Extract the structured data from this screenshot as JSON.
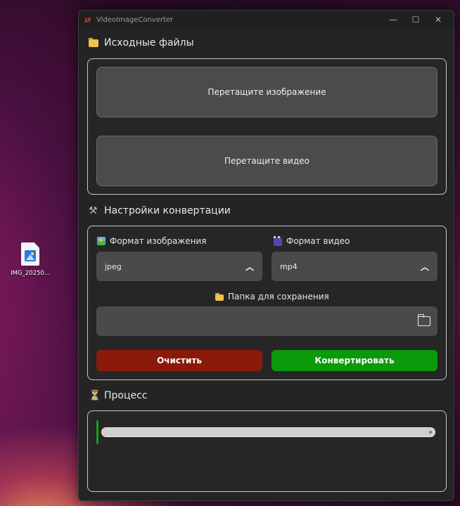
{
  "desktop": {
    "icon_label": "IMG_20250..."
  },
  "window": {
    "title": "VideoImageConverter",
    "controls": {
      "minimize": "—",
      "maximize": "☐",
      "close": "✕"
    }
  },
  "source_section": {
    "title": "Исходные файлы",
    "image_drop": "Перетащите изображение",
    "video_drop": "Перетащите видео"
  },
  "settings_section": {
    "title": "Настройки конвертации",
    "image_format": {
      "label": "Формат изображения",
      "value": "jpeg"
    },
    "video_format": {
      "label": "Формат видео",
      "value": "mp4"
    },
    "save_folder": {
      "label": "Папка для сохранения",
      "value": ""
    },
    "clear_button": "Очистить",
    "convert_button": "Конвертировать"
  },
  "process_section": {
    "title": "Процесс",
    "progress": 0
  },
  "colors": {
    "clear_button": "#8b1a0a",
    "convert_button": "#0a9a0a",
    "progress_accent": "#16a016"
  }
}
